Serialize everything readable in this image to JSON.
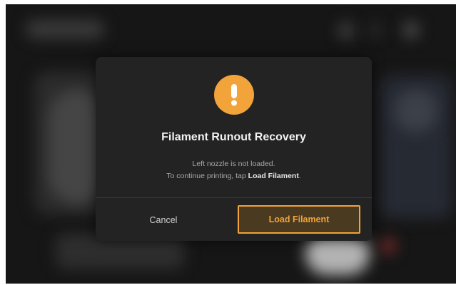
{
  "dialog": {
    "title": "Filament Runout Recovery",
    "message_line1": "Left nozzle is not loaded.",
    "message_line2_prefix": "To continue printing, tap ",
    "message_line2_emphasis": "Load Filament",
    "message_line2_suffix": ".",
    "icon": "warning-exclamation-icon"
  },
  "actions": {
    "cancel_label": "Cancel",
    "load_label": "Load Filament"
  },
  "colors": {
    "accent": "#f2a33a",
    "dialog_bg": "#232323",
    "screen_bg": "#161616"
  }
}
